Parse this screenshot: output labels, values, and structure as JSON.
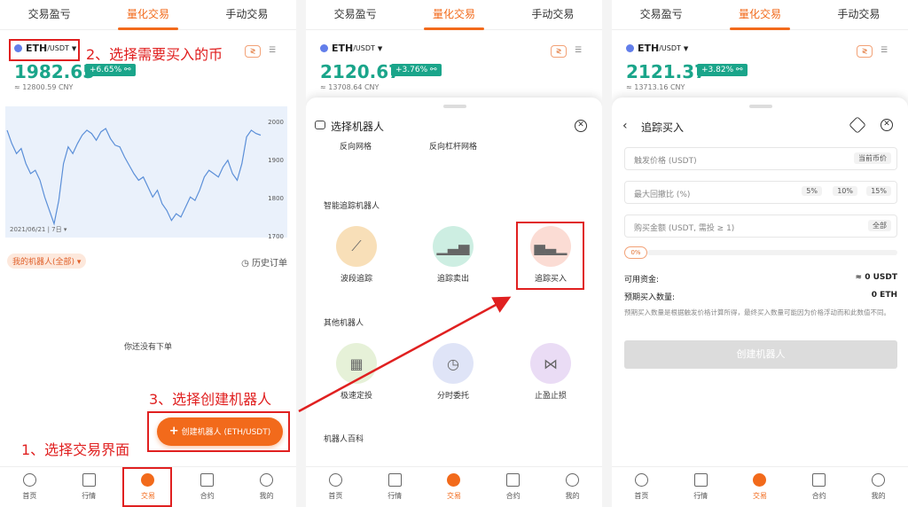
{
  "colors": {
    "accent": "#f26a1b",
    "up": "#1aa58a",
    "annotation": "#e02020",
    "chart_bg": "#eaf1fb",
    "chart_line": "#5b8fd8"
  },
  "top_tabs": [
    "交易盈亏",
    "量化交易",
    "手动交易"
  ],
  "pair": {
    "base": "ETH",
    "quote": "/USDT",
    "dropdown_icon": "caret-down-icon"
  },
  "panels": [
    {
      "price": "1982.65",
      "change": "+6.65%",
      "cny": "≈ 12800.59 CNY"
    },
    {
      "price": "2120.67",
      "change": "+3.76%",
      "cny": "≈ 13708.64 CNY"
    },
    {
      "price": "2121.37",
      "change": "+3.82%",
      "cny": "≈ 13713.16 CNY"
    }
  ],
  "chart_data": {
    "type": "line",
    "date_label": "2021/06/21 | 7日 ▾",
    "y_ticks": [
      2000,
      1900,
      1800,
      1700
    ],
    "ylim": [
      1700,
      2050
    ],
    "values": [
      2000,
      1960,
      1930,
      1945,
      1900,
      1870,
      1880,
      1850,
      1800,
      1760,
      1720,
      1790,
      1900,
      1950,
      1930,
      1960,
      1985,
      2000,
      1990,
      1970,
      1995,
      2005,
      1975,
      1955,
      1950,
      1920,
      1895,
      1870,
      1850,
      1860,
      1830,
      1800,
      1820,
      1780,
      1760,
      1730,
      1750,
      1740,
      1770,
      1800,
      1790,
      1820,
      1860,
      1880,
      1870,
      1860,
      1890,
      1910,
      1870,
      1850,
      1900,
      1980,
      2000,
      1990,
      1985
    ]
  },
  "my_bots_filter": "我的机器人(全部) ▾",
  "history_orders": "历史订单",
  "empty_text": "你还没有下单",
  "create_bot_button": "创建机器人 (ETH/USDT)",
  "bottom_nav": [
    "首页",
    "行情",
    "交易",
    "合约",
    "我的"
  ],
  "annotations": {
    "step1": "1、选择交易界面",
    "step2": "2、选择需要买入的币",
    "step3": "3、选择创建机器人"
  },
  "sheet": {
    "title": "选择机器人",
    "grid_top": [
      "反向网格",
      "反向杠杆网格"
    ],
    "section_smart": "智能追踪机器人",
    "smart": [
      "波段追踪",
      "追踪卖出",
      "追踪买入"
    ],
    "section_other": "其他机器人",
    "other": [
      "极速定投",
      "分时委托",
      "止盈止损"
    ],
    "section_wiki": "机器人百科"
  },
  "form": {
    "title": "追踪买入",
    "trigger_price": "触发价格 (USDT)",
    "current_price_chip": "当前币价",
    "max_pullback": "最大回撤比 (%)",
    "pullback_opts": [
      "5%",
      "10%",
      "15%"
    ],
    "buy_amount": "购买金额 (USDT, 需投 ≥ 1)",
    "all_chip": "全部",
    "slider_pct": "0%",
    "available_label": "可用资金:",
    "available_value": "≈ 0 USDT",
    "est_label": "预期买入数量:",
    "est_value": "0 ETH",
    "note": "预期买入数量是根据触发价格计算所得，最终买入数量可能因为价格浮动而和此数值不同。",
    "submit": "创建机器人"
  }
}
